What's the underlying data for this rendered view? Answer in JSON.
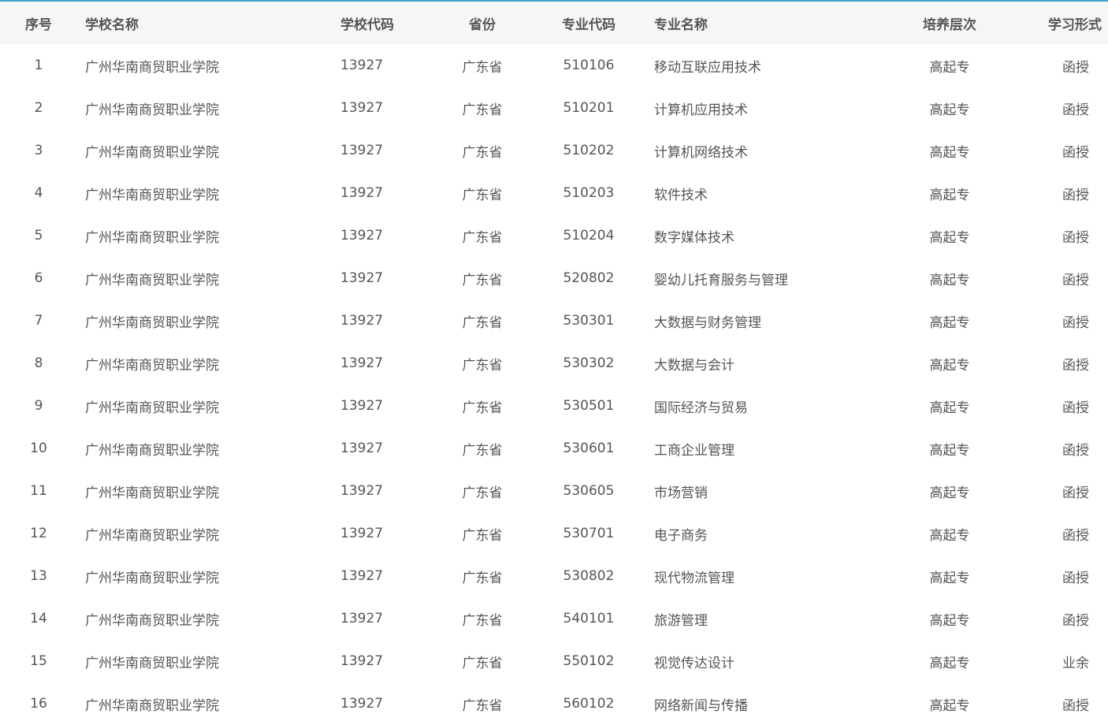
{
  "table": {
    "headers": {
      "idx": "序号",
      "school": "学校名称",
      "code": "学校代码",
      "province": "省份",
      "major_code": "专业代码",
      "major_name": "专业名称",
      "level": "培养层次",
      "form": "学习形式"
    },
    "rows": [
      {
        "idx": "1",
        "school": "广州华南商贸职业学院",
        "code": "13927",
        "province": "广东省",
        "major_code": "510106",
        "major_name": "移动互联应用技术",
        "level": "高起专",
        "form": "函授"
      },
      {
        "idx": "2",
        "school": "广州华南商贸职业学院",
        "code": "13927",
        "province": "广东省",
        "major_code": "510201",
        "major_name": "计算机应用技术",
        "level": "高起专",
        "form": "函授"
      },
      {
        "idx": "3",
        "school": "广州华南商贸职业学院",
        "code": "13927",
        "province": "广东省",
        "major_code": "510202",
        "major_name": "计算机网络技术",
        "level": "高起专",
        "form": "函授"
      },
      {
        "idx": "4",
        "school": "广州华南商贸职业学院",
        "code": "13927",
        "province": "广东省",
        "major_code": "510203",
        "major_name": "软件技术",
        "level": "高起专",
        "form": "函授"
      },
      {
        "idx": "5",
        "school": "广州华南商贸职业学院",
        "code": "13927",
        "province": "广东省",
        "major_code": "510204",
        "major_name": "数字媒体技术",
        "level": "高起专",
        "form": "函授"
      },
      {
        "idx": "6",
        "school": "广州华南商贸职业学院",
        "code": "13927",
        "province": "广东省",
        "major_code": "520802",
        "major_name": "婴幼儿托育服务与管理",
        "level": "高起专",
        "form": "函授"
      },
      {
        "idx": "7",
        "school": "广州华南商贸职业学院",
        "code": "13927",
        "province": "广东省",
        "major_code": "530301",
        "major_name": "大数据与财务管理",
        "level": "高起专",
        "form": "函授"
      },
      {
        "idx": "8",
        "school": "广州华南商贸职业学院",
        "code": "13927",
        "province": "广东省",
        "major_code": "530302",
        "major_name": "大数据与会计",
        "level": "高起专",
        "form": "函授"
      },
      {
        "idx": "9",
        "school": "广州华南商贸职业学院",
        "code": "13927",
        "province": "广东省",
        "major_code": "530501",
        "major_name": "国际经济与贸易",
        "level": "高起专",
        "form": "函授"
      },
      {
        "idx": "10",
        "school": "广州华南商贸职业学院",
        "code": "13927",
        "province": "广东省",
        "major_code": "530601",
        "major_name": "工商企业管理",
        "level": "高起专",
        "form": "函授"
      },
      {
        "idx": "11",
        "school": "广州华南商贸职业学院",
        "code": "13927",
        "province": "广东省",
        "major_code": "530605",
        "major_name": "市场营销",
        "level": "高起专",
        "form": "函授"
      },
      {
        "idx": "12",
        "school": "广州华南商贸职业学院",
        "code": "13927",
        "province": "广东省",
        "major_code": "530701",
        "major_name": "电子商务",
        "level": "高起专",
        "form": "函授"
      },
      {
        "idx": "13",
        "school": "广州华南商贸职业学院",
        "code": "13927",
        "province": "广东省",
        "major_code": "530802",
        "major_name": "现代物流管理",
        "level": "高起专",
        "form": "函授"
      },
      {
        "idx": "14",
        "school": "广州华南商贸职业学院",
        "code": "13927",
        "province": "广东省",
        "major_code": "540101",
        "major_name": "旅游管理",
        "level": "高起专",
        "form": "函授"
      },
      {
        "idx": "15",
        "school": "广州华南商贸职业学院",
        "code": "13927",
        "province": "广东省",
        "major_code": "550102",
        "major_name": "视觉传达设计",
        "level": "高起专",
        "form": "业余"
      },
      {
        "idx": "16",
        "school": "广州华南商贸职业学院",
        "code": "13927",
        "province": "广东省",
        "major_code": "560102",
        "major_name": "网络新闻与传播",
        "level": "高起专",
        "form": "函授"
      }
    ]
  },
  "colors": {
    "accent": "#3aa0c8",
    "header_bg": "#f5f6f7",
    "text": "#555555"
  }
}
